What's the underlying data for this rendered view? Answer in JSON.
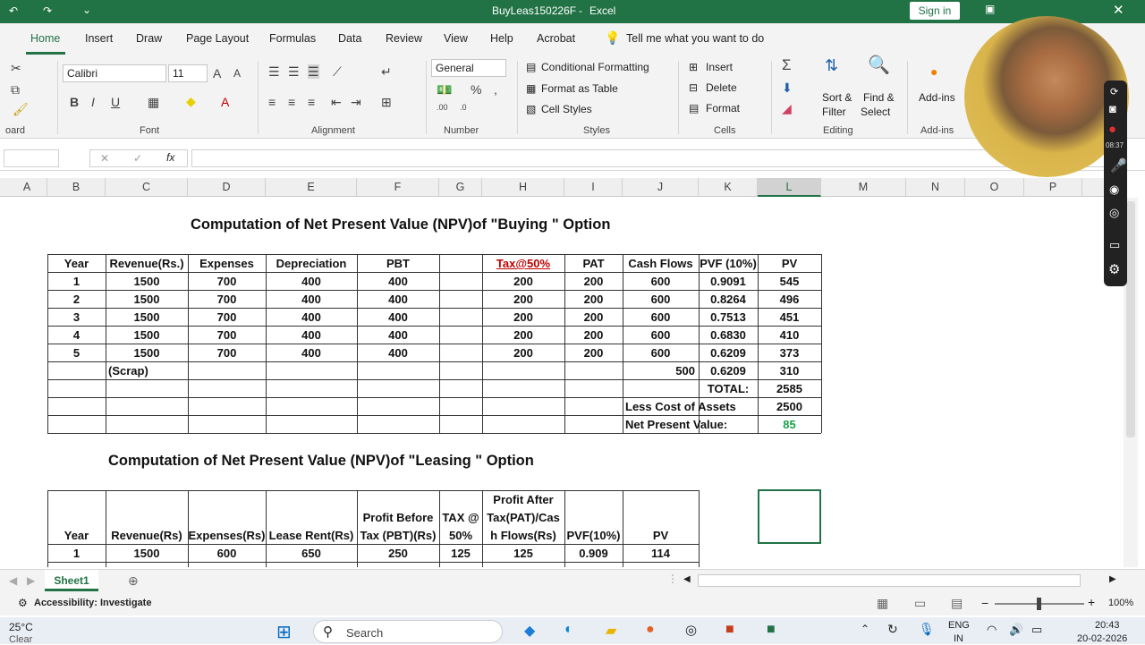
{
  "titlebar": {
    "filename": "BuyLeas150226F",
    "sep": "-",
    "app": "Excel",
    "signin": "Sign in"
  },
  "tabs": [
    "Home",
    "Insert",
    "Draw",
    "Page Layout",
    "Formulas",
    "Data",
    "Review",
    "View",
    "Help",
    "Acrobat"
  ],
  "tellme": "Tell me what you want to do",
  "ribbon": {
    "clipboard": "oard",
    "font_name": "Calibri",
    "font_size": "11",
    "font_label": "Font",
    "alignment_label": "Alignment",
    "number_format": "General",
    "number_label": "Number",
    "cond_fmt": "Conditional Formatting",
    "fmt_table": "Format as Table",
    "cell_styles": "Cell Styles",
    "styles_label": "Styles",
    "insert": "Insert",
    "delete": "Delete",
    "format": "Format",
    "cells_label": "Cells",
    "sort_filter": "Sort &",
    "sort_filter2": "Filter",
    "find_select": "Find &",
    "find_select2": "Select",
    "editing_label": "Editing",
    "addins": "Add-ins",
    "addins_label": "Add-ins",
    "fx": "fx"
  },
  "columns": [
    "A",
    "B",
    "C",
    "D",
    "E",
    "F",
    "G",
    "H",
    "I",
    "J",
    "K",
    "L",
    "M",
    "N",
    "O",
    "P"
  ],
  "buy": {
    "title": "Computation of Net Present Value (NPV)of \"Buying \" Option",
    "headers": [
      "Year",
      "Revenue(Rs.)",
      "Expenses",
      "Depreciation",
      "PBT",
      "",
      "Tax@50%",
      "PAT",
      "Cash Flows",
      "PVF (10%)",
      "PV"
    ],
    "rows": [
      [
        "1",
        "1500",
        "700",
        "400",
        "400",
        "",
        "200",
        "200",
        "600",
        "0.9091",
        "545"
      ],
      [
        "2",
        "1500",
        "700",
        "400",
        "400",
        "",
        "200",
        "200",
        "600",
        "0.8264",
        "496"
      ],
      [
        "3",
        "1500",
        "700",
        "400",
        "400",
        "",
        "200",
        "200",
        "600",
        "0.7513",
        "451"
      ],
      [
        "4",
        "1500",
        "700",
        "400",
        "400",
        "",
        "200",
        "200",
        "600",
        "0.6830",
        "410"
      ],
      [
        "5",
        "1500",
        "700",
        "400",
        "400",
        "",
        "200",
        "200",
        "600",
        "0.6209",
        "373"
      ]
    ],
    "scrap_label": "(Scrap)",
    "scrap_cf": "500",
    "scrap_pvf": "0.6209",
    "scrap_pv": "310",
    "total_label": "TOTAL:",
    "total": "2585",
    "less_label": "Less Cost of Assets",
    "less": "2500",
    "npv_label": "Net Present Value:",
    "npv": "85"
  },
  "lease": {
    "title": "Computation of Net Present Value (NPV)of \"Leasing \" Option",
    "headers": [
      "Year",
      "Revenue(Rs)",
      "Expenses(Rs)",
      "Lease Rent(Rs)",
      "Profit Before",
      "Tax (PBT)(Rs)",
      "TAX @",
      "50%",
      "Profit After",
      "Tax(PAT)/Cas",
      "h Flows(Rs)",
      "PVF(10%)",
      "PV"
    ],
    "row1": [
      "1",
      "1500",
      "600",
      "650",
      "250",
      "125",
      "125",
      "0.909",
      "114"
    ]
  },
  "sheet_tab": "Sheet1",
  "status": {
    "accessibility": "Accessibility: Investigate",
    "zoom": "100%"
  },
  "taskbar": {
    "temp": "25°C",
    "weather": "Clear",
    "search": "Search",
    "lang": "ENG",
    "lang2": "IN",
    "time": "20:43",
    "date": "20-02-2026"
  },
  "cam_time": "08:37"
}
